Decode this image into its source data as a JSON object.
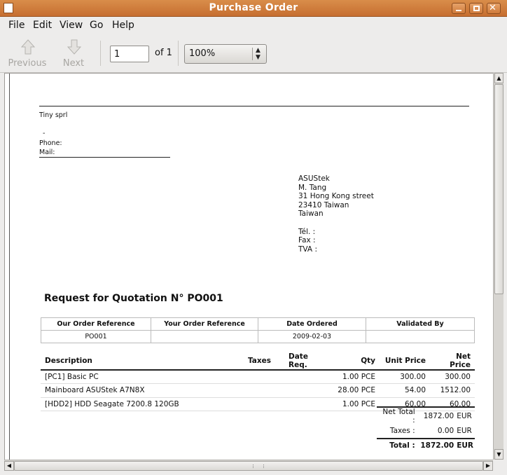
{
  "window": {
    "title": "Purchase Order"
  },
  "menu": {
    "file": "File",
    "edit": "Edit",
    "view": "View",
    "go": "Go",
    "help": "Help"
  },
  "toolbar": {
    "previous": "Previous",
    "next": "Next",
    "page_value": "1",
    "of_label": "of 1",
    "zoom": "100%"
  },
  "document": {
    "company": {
      "name": "Tiny sprl",
      "dash": "-",
      "phone_label": "Phone:",
      "mail_label": "Mail:"
    },
    "supplier": {
      "lines": [
        "ASUStek",
        "M. Tang",
        "31 Hong Kong street",
        "23410 Taiwan",
        "Taiwan"
      ],
      "tel": "Tél. :",
      "fax": "Fax :",
      "tva": "TVA :"
    },
    "title": "Request for Quotation N° PO001",
    "ref_headers": [
      "Our Order Reference",
      "Your Order Reference",
      "Date Ordered",
      "Validated By"
    ],
    "ref_values": [
      "PO001",
      "",
      "2009-02-03",
      ""
    ],
    "line_headers": [
      "Description",
      "Taxes",
      "Date Req.",
      "Qty",
      "Unit Price",
      "Net Price"
    ],
    "lines": [
      [
        "[PC1] Basic PC",
        "",
        "",
        "1.00 PCE",
        "300.00",
        "300.00"
      ],
      [
        "Mainboard ASUStek A7N8X",
        "",
        "",
        "28.00 PCE",
        "54.00",
        "1512.00"
      ],
      [
        "[HDD2] HDD Seagate 7200.8 120GB",
        "",
        "",
        "1.00 PCE",
        "60.00",
        "60.00"
      ]
    ],
    "totals": {
      "net_label": "Net Total :",
      "net_value": "1872.00",
      "net_cur": "EUR",
      "tax_label": "Taxes :",
      "tax_value": "0.00",
      "tax_cur": "EUR",
      "total_label": "Total :",
      "total_value": "1872.00",
      "total_cur": "EUR"
    }
  }
}
